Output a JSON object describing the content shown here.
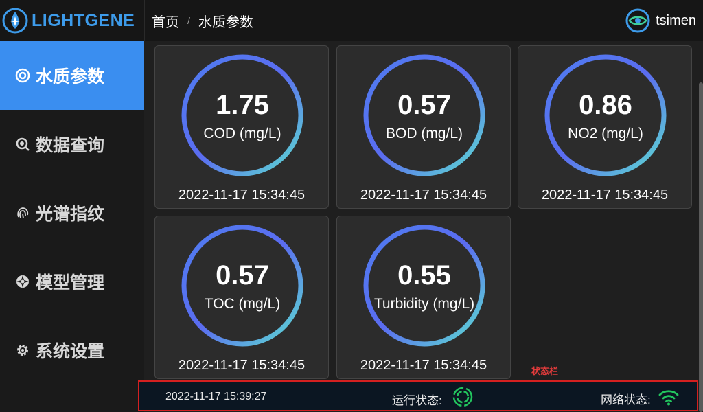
{
  "app": {
    "brand": "LIGHTGENE"
  },
  "sidebar": {
    "items": [
      {
        "label": "水质参数",
        "icon": "target-icon",
        "active": true
      },
      {
        "label": "数据查询",
        "icon": "search-icon",
        "active": false
      },
      {
        "label": "光谱指纹",
        "icon": "fingerprint-icon",
        "active": false
      },
      {
        "label": "模型管理",
        "icon": "aperture-icon",
        "active": false
      },
      {
        "label": "系统设置",
        "icon": "gear-icon",
        "active": false
      }
    ]
  },
  "header": {
    "breadcrumb": [
      "首页",
      "水质参数"
    ],
    "separator": "/",
    "user": "tsimen"
  },
  "cards": [
    {
      "value": "1.75",
      "label": "COD (mg/L)",
      "time": "2022-11-17 15:34:45"
    },
    {
      "value": "0.57",
      "label": "BOD (mg/L)",
      "time": "2022-11-17 15:34:45"
    },
    {
      "value": "0.86",
      "label": "NO2 (mg/L)",
      "time": "2022-11-17 15:34:45"
    },
    {
      "value": "0.57",
      "label": "TOC (mg/L)",
      "time": "2022-11-17 15:34:45"
    },
    {
      "value": "0.55",
      "label": "Turbidity (mg/L)",
      "time": "2022-11-17 15:34:45"
    }
  ],
  "statusbar": {
    "annotation": "状态栏",
    "time": "2022-11-17 15:39:27",
    "run_label": "运行状态:",
    "net_label": "网络状态:",
    "run_icon": "spinner-icon",
    "net_icon": "wifi-icon"
  },
  "colors": {
    "accent": "#3a8ef0",
    "gauge_start": "#5b6cf0",
    "gauge_end": "#5de0d0",
    "status_green": "#22c55e",
    "annotation_red": "#e23b3b"
  }
}
